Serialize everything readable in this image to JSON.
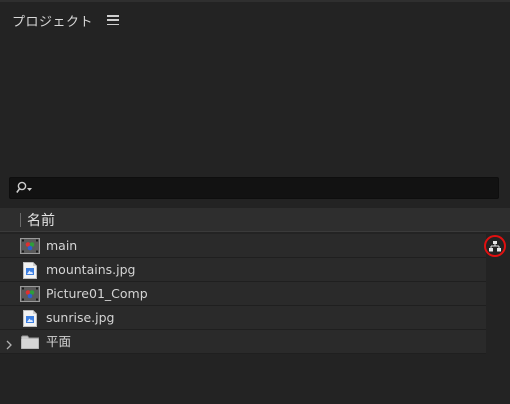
{
  "panel": {
    "title": "プロジェクト",
    "menu_icon": "hamburger-menu-icon"
  },
  "search": {
    "placeholder": "",
    "value": "",
    "icon": "search-icon"
  },
  "columns": {
    "name_header": "名前"
  },
  "items": [
    {
      "label": "main",
      "type": "composition",
      "icon": "composition-icon"
    },
    {
      "label": "mountains.jpg",
      "type": "image",
      "icon": "image-file-icon"
    },
    {
      "label": "Picture01_Comp",
      "type": "composition",
      "icon": "composition-icon"
    },
    {
      "label": "sunrise.jpg",
      "type": "image",
      "icon": "image-file-icon"
    },
    {
      "label": "平面",
      "type": "folder",
      "icon": "folder-icon"
    }
  ],
  "flowchart_button": {
    "icon": "flowchart-icon",
    "highlight_color": "#e01010"
  },
  "colors": {
    "panel_bg": "#232323",
    "row_bg": "#2a2a2a",
    "header_bg": "#2e2e2e",
    "search_bg": "#121212",
    "text": "#d4d4d4"
  }
}
